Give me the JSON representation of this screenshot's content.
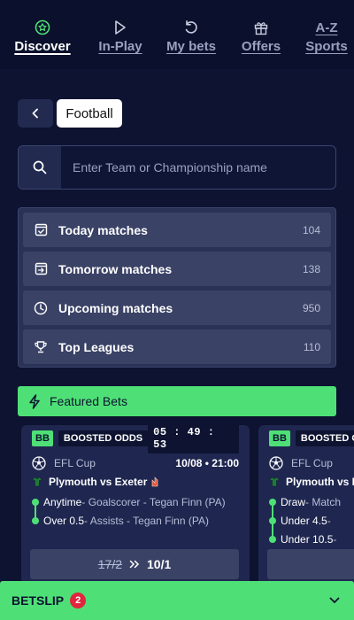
{
  "nav": {
    "items": [
      {
        "label": "Discover",
        "icon": "star-circle-icon",
        "active": true
      },
      {
        "label": "In-Play",
        "icon": "play-icon",
        "active": false
      },
      {
        "label": "My bets",
        "icon": "undo-arrow-icon",
        "active": false
      },
      {
        "label": "Offers",
        "icon": "gift-icon",
        "active": false
      },
      {
        "label": "Sports",
        "icon": "a-z-text",
        "active": false
      }
    ],
    "az_text": "A-Z"
  },
  "breadcrumb": {
    "current": "Football"
  },
  "search": {
    "placeholder": "Enter Team or Championship name"
  },
  "categories": [
    {
      "label": "Today matches",
      "count": "104",
      "icon": "calendar-check-icon"
    },
    {
      "label": "Tomorrow matches",
      "count": "138",
      "icon": "calendar-arrow-icon"
    },
    {
      "label": "Upcoming matches",
      "count": "950",
      "icon": "clock-icon"
    },
    {
      "label": "Top Leagues",
      "count": "110",
      "icon": "trophy-icon"
    }
  ],
  "featured": {
    "label": "Featured Bets",
    "icon": "lightning-icon"
  },
  "cards": [
    {
      "bb": "BB",
      "tag": "BOOSTED ODDS",
      "timer": "05 : 49 : 53",
      "competition": "EFL Cup",
      "datetime": "10/08 • 21:00",
      "match": "Plymouth vs Exeter",
      "selections": [
        {
          "market": "Anytime",
          "detail": " - Goalscorer - Tegan Finn (PA)"
        },
        {
          "market": "Over 0.5",
          "detail": " - Assists - Tegan Finn (PA)"
        }
      ],
      "old_odds": "17/2",
      "new_odds": "10/1"
    },
    {
      "bb": "BB",
      "tag": "BOOSTED ODDS",
      "competition": "EFL Cup",
      "match": "Plymouth vs Exeter",
      "selections": [
        {
          "market": "Draw",
          "detail": " - Match"
        },
        {
          "market": "Under 4.5",
          "detail": " - "
        },
        {
          "market": "Under 10.5",
          "detail": " - "
        }
      ]
    }
  ],
  "betslip": {
    "label": "BETSLIP",
    "count": "2"
  },
  "colors": {
    "accent": "#4ee076",
    "background": "#0d1330",
    "badge": "#e0263c"
  }
}
